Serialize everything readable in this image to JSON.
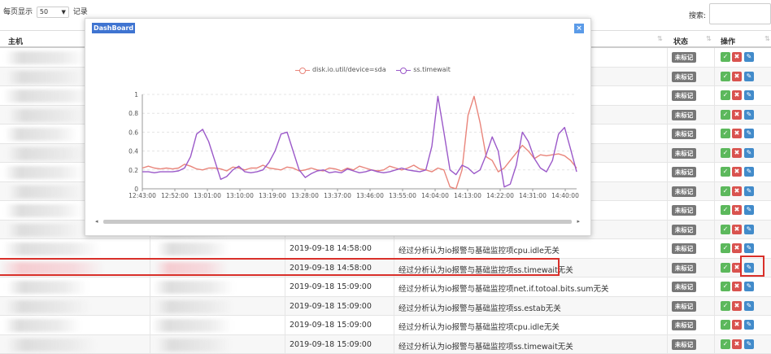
{
  "toolbar": {
    "per_page_label": "每页显示",
    "per_page_value": "50",
    "records_label": "记录",
    "search_label": "搜索:"
  },
  "table": {
    "headers": {
      "host": "主机",
      "status": "状态",
      "action": "操作"
    },
    "rows": [
      {
        "time": "",
        "desc": ""
      },
      {
        "time": "",
        "desc": ""
      },
      {
        "time": "",
        "desc": ""
      },
      {
        "time": "",
        "desc": ""
      },
      {
        "time": "",
        "desc": ""
      },
      {
        "time": "",
        "desc": ""
      },
      {
        "time": "",
        "desc": ""
      },
      {
        "time": "",
        "desc": ""
      },
      {
        "time": "",
        "desc": ""
      },
      {
        "time": "",
        "desc": ""
      },
      {
        "time": "2019-09-18 14:58:00",
        "desc": "经过分析认为io报警与基础监控项cpu.idle无关"
      },
      {
        "time": "2019-09-18 14:58:00",
        "desc": "经过分析认为io报警与基础监控项ss.timewait无关"
      },
      {
        "time": "2019-09-18 15:09:00",
        "desc": "经过分析认为io报警与基础监控项net.if.totoal.bits.sum无关"
      },
      {
        "time": "2019-09-18 15:09:00",
        "desc": "经过分析认为io报警与基础监控项ss.estab无关"
      },
      {
        "time": "2019-09-18 15:09:00",
        "desc": "经过分析认为io报警与基础监控项cpu.idle无关"
      },
      {
        "time": "2019-09-18 15:09:00",
        "desc": "经过分析认为io报警与基础监控项ss.timewait无关"
      }
    ],
    "status_badge": "未标记",
    "icons": {
      "ok": "check-icon",
      "del": "cross-icon",
      "edit": "edit-icon"
    }
  },
  "dashboard": {
    "title": "DashBoard",
    "close_glyph": "×",
    "colors": {
      "io": "#e9857b",
      "tw": "#9b59c9"
    }
  },
  "chart_data": {
    "type": "line",
    "x": [
      "12:43:00",
      "12:52:00",
      "13:01:00",
      "13:10:00",
      "13:19:00",
      "13:28:00",
      "13:37:00",
      "13:46:00",
      "13:55:00",
      "14:04:00",
      "14:13:00",
      "14:22:00",
      "14:31:00",
      "14:40:00"
    ],
    "ylim": [
      0,
      1
    ],
    "yticks": [
      "0",
      "0.2",
      "0.4",
      "0.6",
      "0.8",
      "1"
    ],
    "grid": true,
    "legend": "top-center",
    "series": [
      {
        "name": "disk.io.util/device=sda",
        "values": [
          0.22,
          0.24,
          0.22,
          0.21,
          0.22,
          0.21,
          0.22,
          0.26,
          0.24,
          0.21,
          0.2,
          0.22,
          0.22,
          0.21,
          0.19,
          0.23,
          0.22,
          0.2,
          0.22,
          0.22,
          0.25,
          0.22,
          0.21,
          0.2,
          0.23,
          0.22,
          0.19,
          0.2,
          0.22,
          0.2,
          0.19,
          0.22,
          0.21,
          0.19,
          0.22,
          0.2,
          0.24,
          0.22,
          0.2,
          0.19,
          0.2,
          0.24,
          0.22,
          0.2,
          0.22,
          0.25,
          0.21,
          0.2,
          0.18,
          0.22,
          0.2,
          0.02,
          0.0,
          0.2,
          0.78,
          0.98,
          0.7,
          0.34,
          0.3,
          0.18,
          0.22,
          0.3,
          0.38,
          0.46,
          0.4,
          0.32,
          0.36,
          0.35,
          0.36,
          0.37,
          0.35,
          0.3,
          0.22
        ]
      },
      {
        "name": "ss.timewait",
        "values": [
          0.18,
          0.18,
          0.17,
          0.18,
          0.18,
          0.18,
          0.19,
          0.22,
          0.34,
          0.58,
          0.63,
          0.5,
          0.3,
          0.1,
          0.13,
          0.2,
          0.24,
          0.18,
          0.17,
          0.18,
          0.2,
          0.28,
          0.4,
          0.58,
          0.6,
          0.4,
          0.2,
          0.12,
          0.16,
          0.19,
          0.2,
          0.17,
          0.18,
          0.17,
          0.21,
          0.19,
          0.17,
          0.18,
          0.2,
          0.18,
          0.17,
          0.18,
          0.2,
          0.22,
          0.2,
          0.19,
          0.18,
          0.2,
          0.45,
          0.98,
          0.6,
          0.2,
          0.15,
          0.25,
          0.22,
          0.16,
          0.2,
          0.36,
          0.55,
          0.4,
          0.02,
          0.05,
          0.25,
          0.6,
          0.5,
          0.32,
          0.22,
          0.18,
          0.3,
          0.58,
          0.65,
          0.42,
          0.18
        ]
      }
    ]
  }
}
